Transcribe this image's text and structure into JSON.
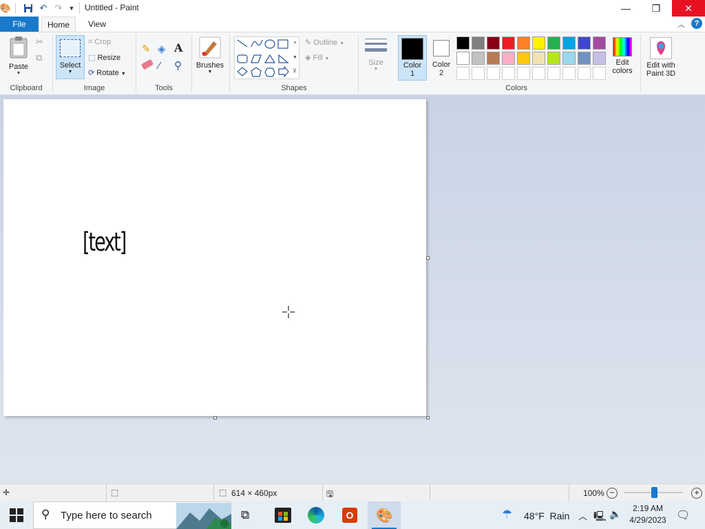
{
  "window": {
    "title": "Untitled - Paint"
  },
  "tabs": {
    "file": "File",
    "home": "Home",
    "view": "View"
  },
  "ribbon": {
    "clipboard": {
      "paste": "Paste",
      "group": "Clipboard"
    },
    "image": {
      "select": "Select",
      "crop": "Crop",
      "resize": "Resize",
      "rotate": "Rotate",
      "group": "Image"
    },
    "tools": {
      "group": "Tools"
    },
    "brushes": {
      "label": "Brushes"
    },
    "shapes": {
      "outline": "Outline",
      "fill": "Fill",
      "group": "Shapes"
    },
    "size": {
      "label": "Size"
    },
    "colors": {
      "color1": "Color",
      "color1_num": "1",
      "color2": "Color",
      "color2_num": "2",
      "edit": "Edit colors",
      "group": "Colors",
      "palette_row1": [
        "#000000",
        "#7f7f7f",
        "#880015",
        "#ed1c24",
        "#ff7f27",
        "#fff200",
        "#22b14c",
        "#00a2e8",
        "#3f48cc",
        "#a349a4"
      ],
      "palette_row2": [
        "#ffffff",
        "#c3c3c3",
        "#b97a57",
        "#ffaec9",
        "#ffc90e",
        "#efe4b0",
        "#b5e61d",
        "#99d9ea",
        "#7092be",
        "#c8bfe7"
      ]
    },
    "paint3d": "Edit with Paint 3D"
  },
  "canvas": {
    "text": "[text]"
  },
  "status": {
    "dimensions": "614 × 460px",
    "zoom": "100%"
  },
  "taskbar": {
    "search_placeholder": "Type here to search",
    "weather": "48°F  Rain",
    "time": "2:19 AM",
    "date": "4/29/2023"
  }
}
